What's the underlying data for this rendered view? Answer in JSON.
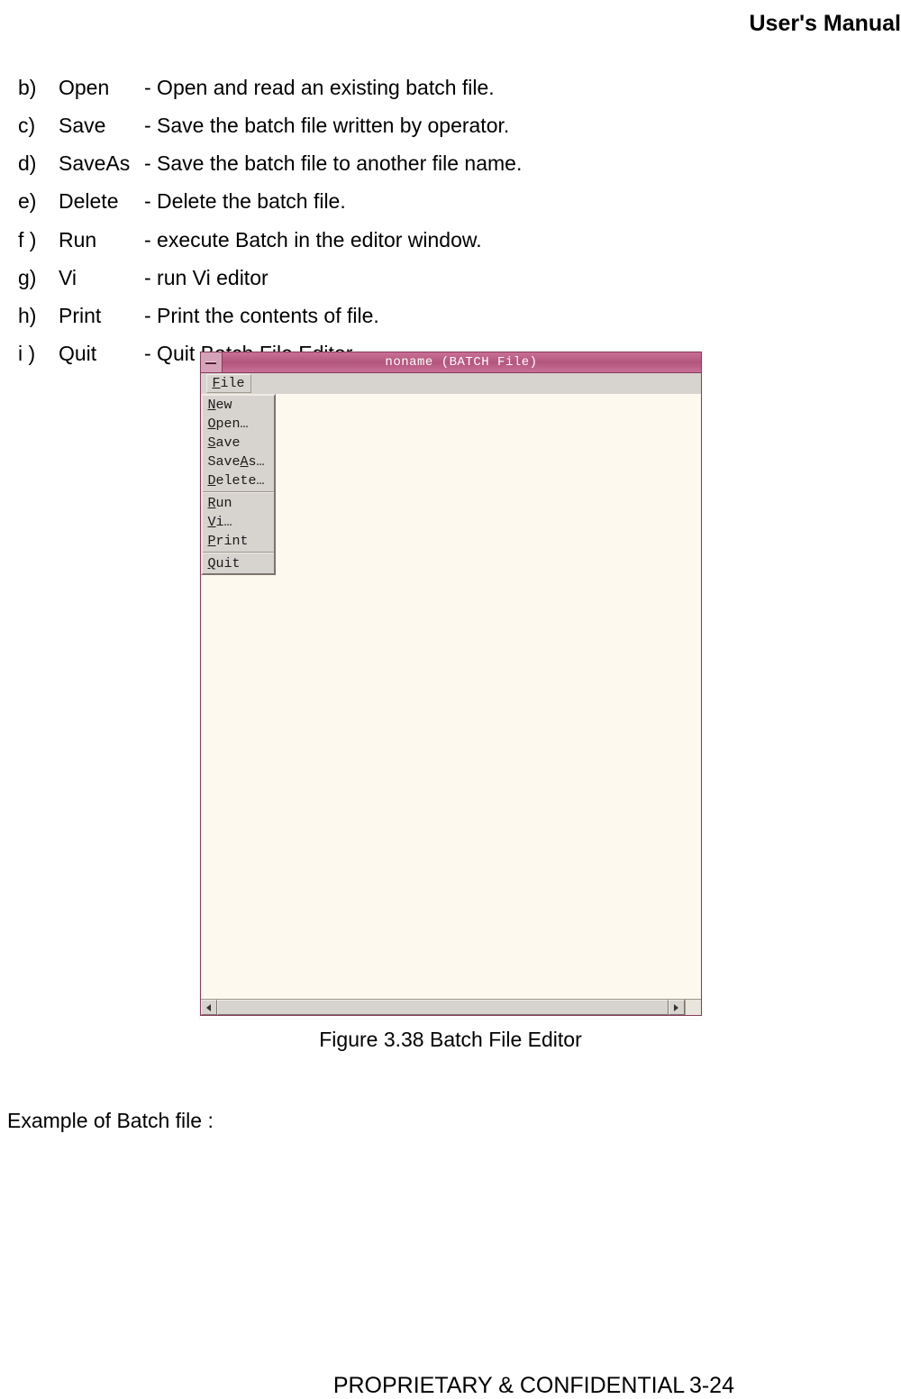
{
  "header": {
    "right": "User's Manual"
  },
  "definitions": [
    {
      "letter": "b)",
      "name": "Open",
      "desc": "- Open and read an existing batch file."
    },
    {
      "letter": "c)",
      "name": "Save",
      "desc": "- Save the batch file written by operator."
    },
    {
      "letter": "d)",
      "name": "SaveAs",
      "desc": "- Save the batch file to another file name."
    },
    {
      "letter": "e)",
      "name": "Delete",
      "desc": "- Delete the batch file."
    },
    {
      "letter": "f )",
      "name": "Run",
      "desc": "- execute Batch in the editor window."
    },
    {
      "letter": "g)",
      "name": "Vi",
      "desc": "- run Vi editor"
    },
    {
      "letter": "h)",
      "name": "Print",
      "desc": "- Print the contents of file."
    },
    {
      "letter": "i )",
      "name": "Quit",
      "desc": "- Quit Batch File Editor."
    }
  ],
  "window": {
    "title": "noname (BATCH File)",
    "menubar": {
      "file": "File",
      "file_ul": "F",
      "file_rest": "ile"
    },
    "menu": {
      "new": {
        "ul": "N",
        "rest": "ew"
      },
      "open": {
        "ul": "O",
        "rest": "pen…"
      },
      "save": {
        "ul": "S",
        "rest": "ave"
      },
      "saveas": {
        "pre": "Save",
        "ul": "A",
        "rest": "s…"
      },
      "delete": {
        "ul": "D",
        "rest": "elete…"
      },
      "run": {
        "ul": "R",
        "rest": "un"
      },
      "vi": {
        "ul": "V",
        "rest": "i…"
      },
      "print": {
        "ul": "P",
        "rest": "rint"
      },
      "quit": {
        "ul": "Q",
        "rest": "uit"
      }
    }
  },
  "figure_caption": "Figure 3.38 Batch File Editor",
  "example_label": "Example of Batch file :",
  "footer": {
    "text": "PROPRIETARY & CONFIDENTIAL",
    "page": "3-24"
  }
}
